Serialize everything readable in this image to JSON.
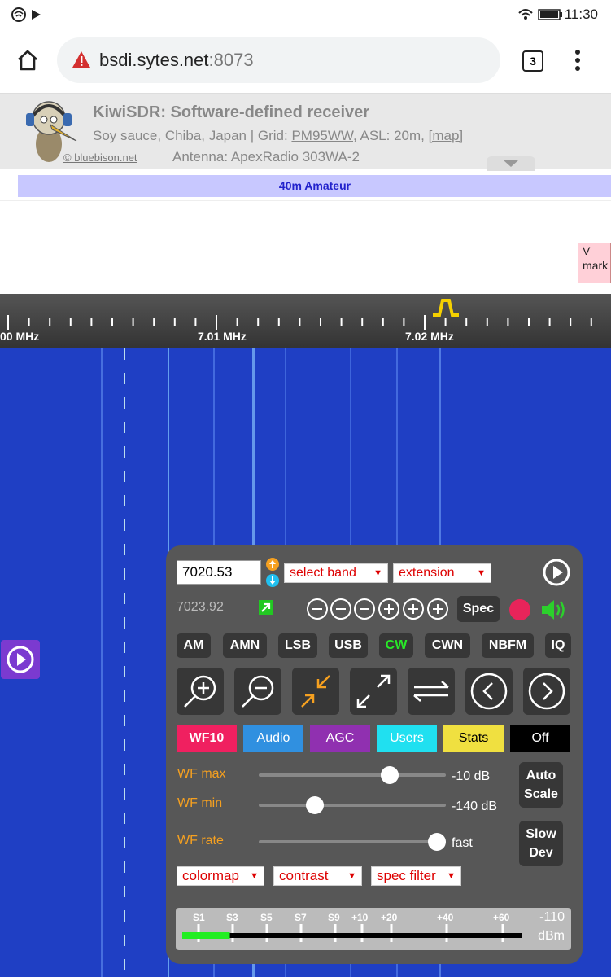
{
  "status": {
    "time": "11:30"
  },
  "browser": {
    "host": "bsdi.sytes.net",
    "port": ":8073",
    "tab_count": "3"
  },
  "kiwi": {
    "title": "KiwiSDR: Software-defined receiver",
    "location_prefix": "Soy sauce, Chiba, Japan | Grid: ",
    "grid": "PM95WW",
    "asl": ", ASL: 20m, ",
    "map_link": "[map]",
    "copyright": "© bluebison.net",
    "antenna": "Antenna: ApexRadio 303WA-2"
  },
  "band_label": "40m Amateur",
  "marker_label_1": "V",
  "marker_label_2": "mark",
  "scale": {
    "labels": [
      "00 MHz",
      "7.01 MHz",
      "7.02 MHz"
    ]
  },
  "panel": {
    "frequency": "7020.53",
    "select_band": "select band",
    "extension": "extension",
    "last_freq": "7023.92",
    "spec_label": "Spec",
    "modes": [
      "AM",
      "AMN",
      "LSB",
      "USB",
      "CW",
      "CWN",
      "NBFM",
      "IQ"
    ],
    "active_mode": "CW",
    "tabs": [
      "WF10",
      "Audio",
      "AGC",
      "Users",
      "Stats",
      "Off"
    ],
    "wf_max_label": "WF max",
    "wf_max_value": "-10 dB",
    "wf_max_level": 0.7,
    "wf_min_label": "WF min",
    "wf_min_value": "-140 dB",
    "wf_min_level": 0.3,
    "wf_rate_label": "WF rate",
    "wf_rate_value": "fast",
    "wf_rate_level": 0.95,
    "auto_scale_1": "Auto",
    "auto_scale_2": "Scale",
    "slow_dev_1": "Slow",
    "slow_dev_2": "Dev",
    "colormap": "colormap",
    "contrast": "contrast",
    "spec_filter": "spec filter",
    "smeter_ticks": [
      "S1",
      "S3",
      "S5",
      "S7",
      "S9",
      "+10",
      "+20",
      "+40",
      "+60"
    ],
    "smeter_value": "-110",
    "smeter_unit": "dBm",
    "smeter_level": 0.14
  },
  "colors": {
    "waterfall": "#1f3fc4",
    "panel": "#575757",
    "active_mode": "#28e828"
  }
}
